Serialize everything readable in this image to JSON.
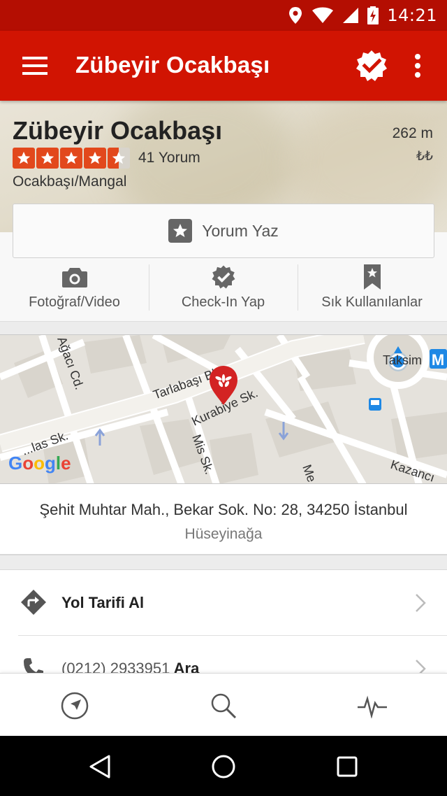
{
  "status_bar": {
    "time": "14:21",
    "icons": [
      "location-icon",
      "wifi-icon",
      "signal-icon",
      "battery-charging-icon"
    ]
  },
  "app_bar": {
    "title": "Zübeyir Ocakbaşı",
    "icons": [
      "menu-icon",
      "verified-badge-icon",
      "more-vert-icon"
    ]
  },
  "business": {
    "name": "Zübeyir Ocakbaşı",
    "rating_stars": 4.5,
    "review_count": "41 Yorum",
    "category": "Ocakbaşı/Mangal",
    "distance": "262 m",
    "price": "₺₺",
    "accent_color": "#d11402",
    "star_color": "#e2481c"
  },
  "write_review": {
    "label": "Yorum Yaz",
    "icon": "star-box-icon"
  },
  "actions": [
    {
      "label": "Fotoğraf/Video",
      "icon": "camera-icon"
    },
    {
      "label": "Check-In Yap",
      "icon": "check-badge-icon"
    },
    {
      "label": "Sık Kullanılanlar",
      "icon": "bookmark-star-icon"
    }
  ],
  "map": {
    "labels": {
      "street_main": "Tarlabaşı Blv",
      "street_kurabiye": "Kurabiye Sk.",
      "street_mis": "Mis Sk.",
      "street_agaci": "Ağacı Cd.",
      "street_sk_left": "...las Sk.",
      "station": "Taksim",
      "metro": "M",
      "kazanci": "Kazancı",
      "me": "Me"
    },
    "attribution": "Google"
  },
  "address": {
    "line": "Şehit Muhtar Mah., Bekar Sok. No: 28, 34250 İstanbul",
    "neighborhood": "Hüseyinağa"
  },
  "list": [
    {
      "label": "Yol Tarifi Al",
      "icon": "directions-icon"
    },
    {
      "label_muted": "(0212) 2933951",
      "label": "Ara",
      "icon": "phone-icon"
    }
  ],
  "tab_bar": {
    "icons": [
      "nearby-compass-icon",
      "search-icon",
      "activity-icon"
    ]
  },
  "nav_bar": {
    "icons": [
      "back-icon",
      "home-icon",
      "recents-icon"
    ]
  }
}
